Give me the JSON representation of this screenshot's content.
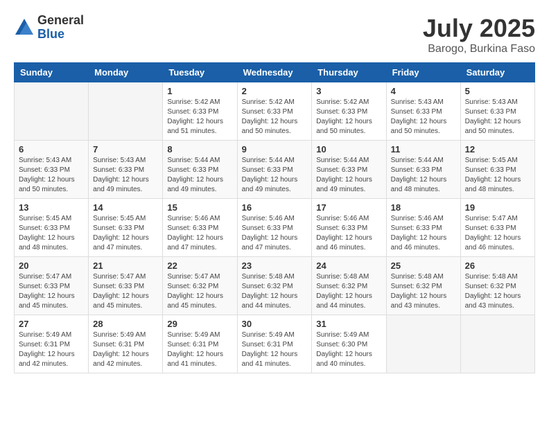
{
  "logo": {
    "general": "General",
    "blue": "Blue"
  },
  "title": "July 2025",
  "location": "Barogo, Burkina Faso",
  "days_of_week": [
    "Sunday",
    "Monday",
    "Tuesday",
    "Wednesday",
    "Thursday",
    "Friday",
    "Saturday"
  ],
  "weeks": [
    [
      {
        "day": "",
        "info": ""
      },
      {
        "day": "",
        "info": ""
      },
      {
        "day": "1",
        "info": "Sunrise: 5:42 AM\nSunset: 6:33 PM\nDaylight: 12 hours and 51 minutes."
      },
      {
        "day": "2",
        "info": "Sunrise: 5:42 AM\nSunset: 6:33 PM\nDaylight: 12 hours and 50 minutes."
      },
      {
        "day": "3",
        "info": "Sunrise: 5:42 AM\nSunset: 6:33 PM\nDaylight: 12 hours and 50 minutes."
      },
      {
        "day": "4",
        "info": "Sunrise: 5:43 AM\nSunset: 6:33 PM\nDaylight: 12 hours and 50 minutes."
      },
      {
        "day": "5",
        "info": "Sunrise: 5:43 AM\nSunset: 6:33 PM\nDaylight: 12 hours and 50 minutes."
      }
    ],
    [
      {
        "day": "6",
        "info": "Sunrise: 5:43 AM\nSunset: 6:33 PM\nDaylight: 12 hours and 50 minutes."
      },
      {
        "day": "7",
        "info": "Sunrise: 5:43 AM\nSunset: 6:33 PM\nDaylight: 12 hours and 49 minutes."
      },
      {
        "day": "8",
        "info": "Sunrise: 5:44 AM\nSunset: 6:33 PM\nDaylight: 12 hours and 49 minutes."
      },
      {
        "day": "9",
        "info": "Sunrise: 5:44 AM\nSunset: 6:33 PM\nDaylight: 12 hours and 49 minutes."
      },
      {
        "day": "10",
        "info": "Sunrise: 5:44 AM\nSunset: 6:33 PM\nDaylight: 12 hours and 49 minutes."
      },
      {
        "day": "11",
        "info": "Sunrise: 5:44 AM\nSunset: 6:33 PM\nDaylight: 12 hours and 48 minutes."
      },
      {
        "day": "12",
        "info": "Sunrise: 5:45 AM\nSunset: 6:33 PM\nDaylight: 12 hours and 48 minutes."
      }
    ],
    [
      {
        "day": "13",
        "info": "Sunrise: 5:45 AM\nSunset: 6:33 PM\nDaylight: 12 hours and 48 minutes."
      },
      {
        "day": "14",
        "info": "Sunrise: 5:45 AM\nSunset: 6:33 PM\nDaylight: 12 hours and 47 minutes."
      },
      {
        "day": "15",
        "info": "Sunrise: 5:46 AM\nSunset: 6:33 PM\nDaylight: 12 hours and 47 minutes."
      },
      {
        "day": "16",
        "info": "Sunrise: 5:46 AM\nSunset: 6:33 PM\nDaylight: 12 hours and 47 minutes."
      },
      {
        "day": "17",
        "info": "Sunrise: 5:46 AM\nSunset: 6:33 PM\nDaylight: 12 hours and 46 minutes."
      },
      {
        "day": "18",
        "info": "Sunrise: 5:46 AM\nSunset: 6:33 PM\nDaylight: 12 hours and 46 minutes."
      },
      {
        "day": "19",
        "info": "Sunrise: 5:47 AM\nSunset: 6:33 PM\nDaylight: 12 hours and 46 minutes."
      }
    ],
    [
      {
        "day": "20",
        "info": "Sunrise: 5:47 AM\nSunset: 6:33 PM\nDaylight: 12 hours and 45 minutes."
      },
      {
        "day": "21",
        "info": "Sunrise: 5:47 AM\nSunset: 6:33 PM\nDaylight: 12 hours and 45 minutes."
      },
      {
        "day": "22",
        "info": "Sunrise: 5:47 AM\nSunset: 6:32 PM\nDaylight: 12 hours and 45 minutes."
      },
      {
        "day": "23",
        "info": "Sunrise: 5:48 AM\nSunset: 6:32 PM\nDaylight: 12 hours and 44 minutes."
      },
      {
        "day": "24",
        "info": "Sunrise: 5:48 AM\nSunset: 6:32 PM\nDaylight: 12 hours and 44 minutes."
      },
      {
        "day": "25",
        "info": "Sunrise: 5:48 AM\nSunset: 6:32 PM\nDaylight: 12 hours and 43 minutes."
      },
      {
        "day": "26",
        "info": "Sunrise: 5:48 AM\nSunset: 6:32 PM\nDaylight: 12 hours and 43 minutes."
      }
    ],
    [
      {
        "day": "27",
        "info": "Sunrise: 5:49 AM\nSunset: 6:31 PM\nDaylight: 12 hours and 42 minutes."
      },
      {
        "day": "28",
        "info": "Sunrise: 5:49 AM\nSunset: 6:31 PM\nDaylight: 12 hours and 42 minutes."
      },
      {
        "day": "29",
        "info": "Sunrise: 5:49 AM\nSunset: 6:31 PM\nDaylight: 12 hours and 41 minutes."
      },
      {
        "day": "30",
        "info": "Sunrise: 5:49 AM\nSunset: 6:31 PM\nDaylight: 12 hours and 41 minutes."
      },
      {
        "day": "31",
        "info": "Sunrise: 5:49 AM\nSunset: 6:30 PM\nDaylight: 12 hours and 40 minutes."
      },
      {
        "day": "",
        "info": ""
      },
      {
        "day": "",
        "info": ""
      }
    ]
  ]
}
